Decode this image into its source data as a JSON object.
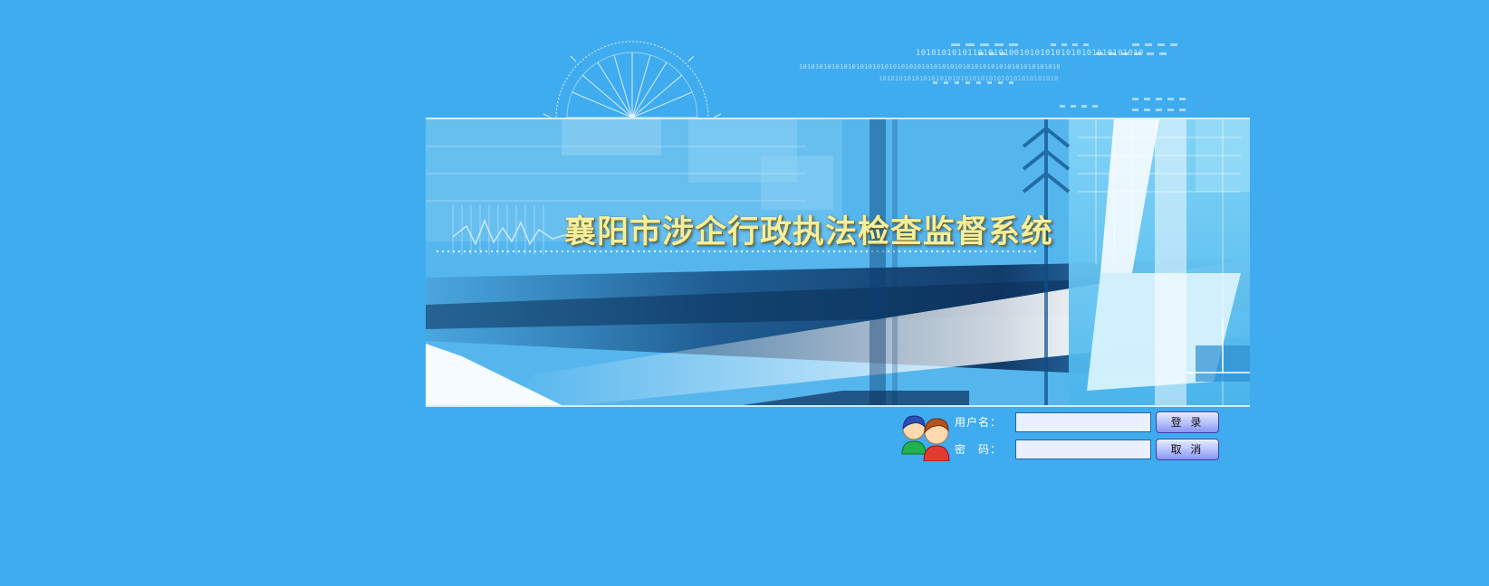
{
  "banner": {
    "title": "襄阳市涉企行政执法检查监督系统"
  },
  "decor": {
    "binary_line_1": "10101010101101010100101010101010101010101010",
    "binary_line_2": "1010101010101010101010101010101010101010101010101010101010101010",
    "binary_line_3": "10101010101010101010101010101010101010101010"
  },
  "login": {
    "username_label": "用户名：",
    "password_label": "密　码：",
    "username_value": "",
    "password_value": "",
    "login_button": "登 录",
    "cancel_button": "取 消"
  },
  "colors": {
    "page_background": "#3facef",
    "title_text": "#f2ef9e",
    "input_background": "#eaf0ff",
    "button_border": "#3d3fa8"
  },
  "icons": {
    "avatar": "users-icon"
  }
}
